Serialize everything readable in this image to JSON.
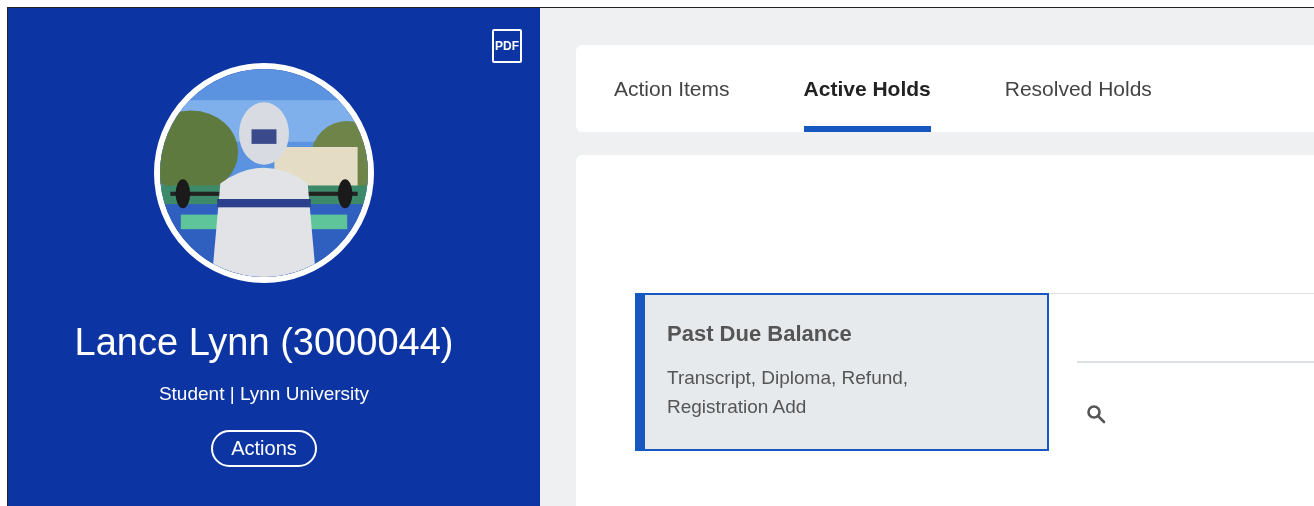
{
  "profile": {
    "pdf_label": "PDF",
    "name": "Lance Lynn (3000044)",
    "subtitle": "Student | Lynn University",
    "actions_button": "Actions"
  },
  "tabs": [
    {
      "label": "Action Items",
      "selected": false
    },
    {
      "label": "Active Holds",
      "selected": true
    },
    {
      "label": "Resolved Holds",
      "selected": false
    }
  ],
  "holds": [
    {
      "title": "Past Due Balance",
      "description": "Transcript, Diploma, Refund, Registration Add",
      "selected": true
    }
  ]
}
